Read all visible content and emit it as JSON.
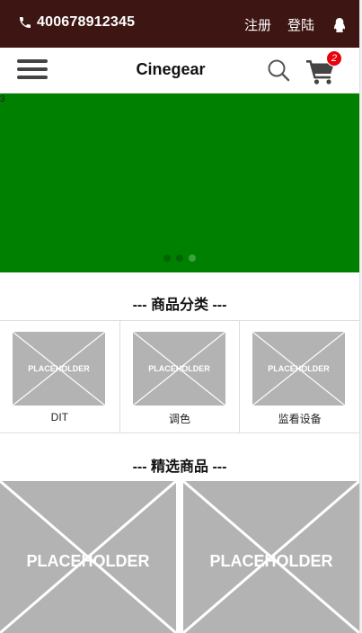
{
  "topbar": {
    "phone_number": "400678912345",
    "register_label": "注册",
    "login_label": "登陆",
    "bg_color": "#3d1513"
  },
  "navbar": {
    "brand": "Cinegear",
    "cart_count": "2",
    "badge_color": "#e8000b"
  },
  "banner": {
    "bg_color": "#008000",
    "slide_index": "3",
    "slides": 3,
    "active_slide": 3
  },
  "categories": {
    "title": "--- 商品分类 ---",
    "items": [
      {
        "image_label": "PLACEHOLDER",
        "name": "DIT"
      },
      {
        "image_label": "PLACEHOLDER",
        "name": "调色"
      },
      {
        "image_label": "PLACEHOLDER",
        "name": "监看设备"
      }
    ]
  },
  "featured": {
    "title": "--- 精选商品 ---",
    "items": [
      {
        "image_label": "PLACEHOLDER"
      },
      {
        "image_label": "PLACEHOLDER"
      }
    ]
  },
  "icons": {
    "phone": "phone-icon",
    "qq": "qq-penguin-icon",
    "menu": "hamburger-menu-icon",
    "search": "search-icon",
    "cart": "shopping-cart-icon"
  }
}
